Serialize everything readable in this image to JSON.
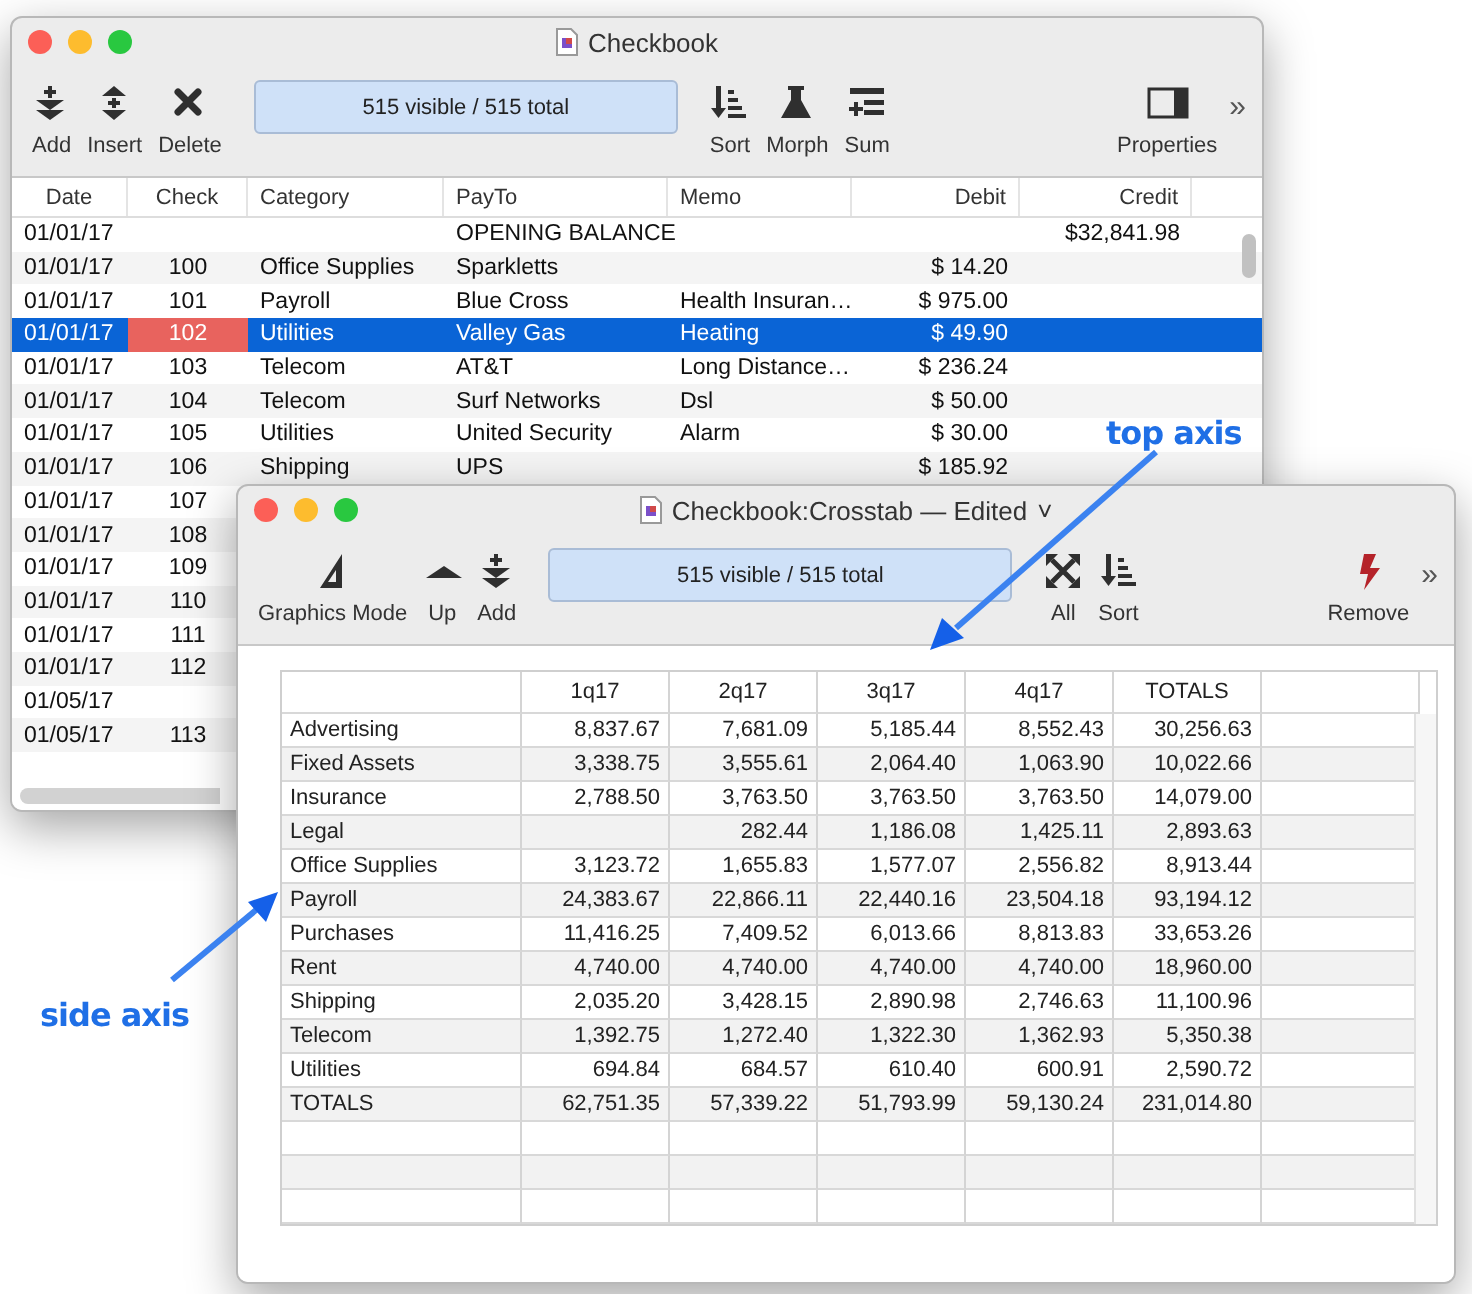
{
  "checkbook": {
    "title": "Checkbook",
    "toolbar_left": [
      {
        "kind": "add",
        "label": "Add"
      },
      {
        "kind": "insert",
        "label": "Insert"
      },
      {
        "kind": "delete",
        "label": "Delete"
      }
    ],
    "status": "515 visible / 515 total",
    "toolbar_right": [
      {
        "kind": "sort",
        "label": "Sort"
      },
      {
        "kind": "morph",
        "label": "Morph"
      },
      {
        "kind": "sum",
        "label": "Sum"
      }
    ],
    "toolbar_far": [
      {
        "kind": "properties",
        "label": "Properties"
      }
    ],
    "overflow": "»",
    "columns": [
      "Date",
      "Check",
      "Category",
      "PayTo",
      "Memo",
      "Debit",
      "Credit"
    ],
    "rows": [
      {
        "date": "01/01/17",
        "payto": "OPENING BALANCE",
        "credit": "$32,841.98",
        "selected": false,
        "flagged": false
      },
      {
        "date": "01/01/17",
        "check": "100",
        "category": "Office Supplies",
        "payto": "Sparkletts",
        "debit": "$ 14.20",
        "selected": false,
        "flagged": false
      },
      {
        "date": "01/01/17",
        "check": "101",
        "category": "Payroll",
        "payto": "Blue Cross",
        "memo": "Health Insuran…",
        "debit": "$ 975.00",
        "selected": false,
        "flagged": false
      },
      {
        "date": "01/01/17",
        "check": "102",
        "category": "Utilities",
        "payto": "Valley Gas",
        "memo": "Heating",
        "debit": "$ 49.90",
        "selected": true,
        "flagged": true
      },
      {
        "date": "01/01/17",
        "check": "103",
        "category": "Telecom",
        "payto": "AT&T",
        "memo": "Long Distance…",
        "debit": "$ 236.24",
        "selected": false,
        "flagged": false
      },
      {
        "date": "01/01/17",
        "check": "104",
        "category": "Telecom",
        "payto": "Surf Networks",
        "memo": "Dsl",
        "debit": "$ 50.00",
        "selected": false,
        "flagged": false
      },
      {
        "date": "01/01/17",
        "check": "105",
        "category": "Utilities",
        "payto": "United Security",
        "memo": "Alarm",
        "debit": "$ 30.00",
        "selected": false,
        "flagged": false
      },
      {
        "date": "01/01/17",
        "check": "106",
        "category": "Shipping",
        "payto": "UPS",
        "debit": "$ 185.92",
        "selected": false,
        "flagged": false
      },
      {
        "date": "01/01/17",
        "check": "107",
        "selected": false,
        "flagged": false
      },
      {
        "date": "01/01/17",
        "check": "108",
        "selected": false,
        "flagged": false
      },
      {
        "date": "01/01/17",
        "check": "109",
        "selected": false,
        "flagged": false
      },
      {
        "date": "01/01/17",
        "check": "110",
        "selected": false,
        "flagged": false
      },
      {
        "date": "01/01/17",
        "check": "111",
        "selected": false,
        "flagged": false
      },
      {
        "date": "01/01/17",
        "check": "112",
        "selected": false,
        "flagged": false
      },
      {
        "date": "01/05/17",
        "selected": false,
        "flagged": false
      },
      {
        "date": "01/05/17",
        "check": "113",
        "selected": false,
        "flagged": false
      }
    ]
  },
  "crosstab": {
    "title": "Checkbook:Crosstab — Edited",
    "title_menu": "˅",
    "toolbar_left": [
      {
        "kind": "graphics",
        "label": "Graphics Mode"
      },
      {
        "kind": "up",
        "label": "Up"
      },
      {
        "kind": "add",
        "label": "Add"
      }
    ],
    "status": "515 visible / 515 total",
    "toolbar_right": [
      {
        "kind": "all",
        "label": "All"
      },
      {
        "kind": "sort",
        "label": "Sort"
      }
    ],
    "toolbar_far": [
      {
        "kind": "remove",
        "label": "Remove"
      }
    ],
    "overflow": "»",
    "columns": [
      "1q17",
      "2q17",
      "3q17",
      "4q17",
      "TOTALS"
    ],
    "rows": [
      {
        "label": "Advertising",
        "q1": "8,837.67",
        "q2": "7,681.09",
        "q3": "5,185.44",
        "q4": "8,552.43",
        "total": "30,256.63"
      },
      {
        "label": "Fixed Assets",
        "q1": "3,338.75",
        "q2": "3,555.61",
        "q3": "2,064.40",
        "q4": "1,063.90",
        "total": "10,022.66"
      },
      {
        "label": "Insurance",
        "q1": "2,788.50",
        "q2": "3,763.50",
        "q3": "3,763.50",
        "q4": "3,763.50",
        "total": "14,079.00"
      },
      {
        "label": "Legal",
        "q2": "282.44",
        "q3": "1,186.08",
        "q4": "1,425.11",
        "total": "2,893.63"
      },
      {
        "label": "Office Supplies",
        "q1": "3,123.72",
        "q2": "1,655.83",
        "q3": "1,577.07",
        "q4": "2,556.82",
        "total": "8,913.44"
      },
      {
        "label": "Payroll",
        "q1": "24,383.67",
        "q2": "22,866.11",
        "q3": "22,440.16",
        "q4": "23,504.18",
        "total": "93,194.12"
      },
      {
        "label": "Purchases",
        "q1": "11,416.25",
        "q2": "7,409.52",
        "q3": "6,013.66",
        "q4": "8,813.83",
        "total": "33,653.26"
      },
      {
        "label": "Rent",
        "q1": "4,740.00",
        "q2": "4,740.00",
        "q3": "4,740.00",
        "q4": "4,740.00",
        "total": "18,960.00"
      },
      {
        "label": "Shipping",
        "q1": "2,035.20",
        "q2": "3,428.15",
        "q3": "2,890.98",
        "q4": "2,746.63",
        "total": "11,100.96"
      },
      {
        "label": "Telecom",
        "q1": "1,392.75",
        "q2": "1,272.40",
        "q3": "1,322.30",
        "q4": "1,362.93",
        "total": "5,350.38"
      },
      {
        "label": "Utilities",
        "q1": "694.84",
        "q2": "684.57",
        "q3": "610.40",
        "q4": "600.91",
        "total": "2,590.72"
      },
      {
        "label": "TOTALS",
        "q1": "62,751.35",
        "q2": "57,339.22",
        "q3": "51,793.99",
        "q4": "59,130.24",
        "total": "231,014.80"
      }
    ]
  },
  "annotations": [
    {
      "kind": "top",
      "text": "top axis"
    },
    {
      "kind": "side",
      "text": "side axis"
    }
  ]
}
